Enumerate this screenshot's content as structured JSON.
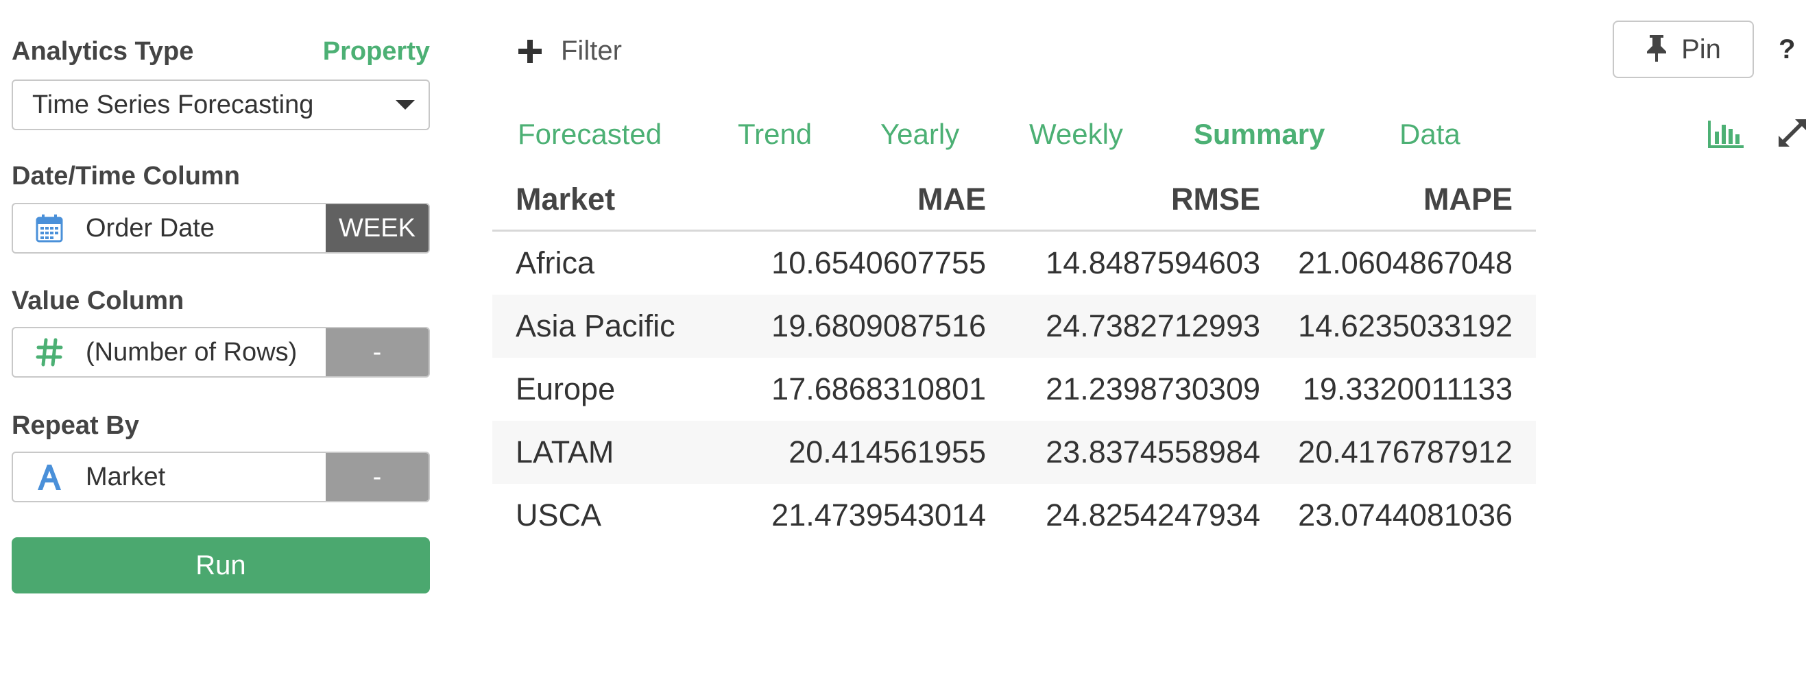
{
  "sidebar": {
    "analytics_type_label": "Analytics Type",
    "property_link": "Property",
    "analytics_type_value": "Time Series Forecasting",
    "datetime_label": "Date/Time Column",
    "datetime_value": "Order Date",
    "datetime_unit": "WEEK",
    "value_label": "Value Column",
    "value_value": "(Number of Rows)",
    "value_side": "-",
    "repeat_label": "Repeat By",
    "repeat_value": "Market",
    "repeat_side": "-",
    "run_label": "Run"
  },
  "toolbar": {
    "filter_label": "Filter",
    "pin_label": "Pin",
    "help_label": "?"
  },
  "tabs": [
    {
      "label": "Forecasted"
    },
    {
      "label": "Trend"
    },
    {
      "label": "Yearly"
    },
    {
      "label": "Weekly"
    },
    {
      "label": "Summary"
    },
    {
      "label": "Data"
    }
  ],
  "active_tab": "Summary",
  "colors": {
    "accent": "#4cb074",
    "run_button": "#4ba86f",
    "calendar_icon": "#4a90d9",
    "number_icon": "#4cb074",
    "text_icon": "#4a90d9"
  },
  "icons": {
    "filter": "plus-icon",
    "pin": "pin-icon",
    "datetime": "calendar-icon",
    "value": "hash-icon",
    "repeat": "text-type-icon",
    "chart": "bar-chart-icon",
    "expand": "expand-icon"
  },
  "table": {
    "columns": [
      "Market",
      "MAE",
      "RMSE",
      "MAPE"
    ],
    "rows": [
      [
        "Africa",
        "10.6540607755",
        "14.8487594603",
        "21.0604867048"
      ],
      [
        "Asia Pacific",
        "19.6809087516",
        "24.7382712993",
        "14.6235033192"
      ],
      [
        "Europe",
        "17.6868310801",
        "21.2398730309",
        "19.3320011133"
      ],
      [
        "LATAM",
        "20.414561955",
        "23.8374558984",
        "20.4176787912"
      ],
      [
        "USCA",
        "21.4739543014",
        "24.8254247934",
        "23.0744081036"
      ]
    ]
  }
}
